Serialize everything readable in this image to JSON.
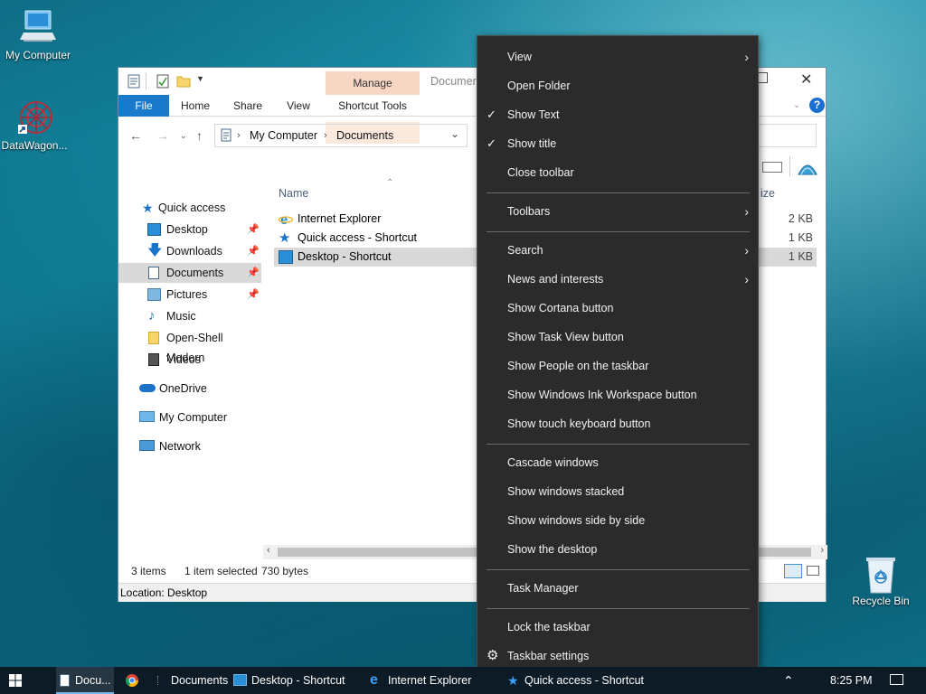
{
  "desktop": {
    "icons": [
      {
        "label": "My Computer",
        "icon": "computer-icon"
      },
      {
        "label": "DataWagon...",
        "icon": "datawagon-icon"
      },
      {
        "label": "Recycle Bin",
        "icon": "recycle-bin-icon"
      }
    ]
  },
  "explorer": {
    "title_partial": "Documer",
    "ribbon": {
      "context_group": "Manage",
      "tabs": [
        "File",
        "Home",
        "Share",
        "View",
        "Shortcut Tools"
      ]
    },
    "address": {
      "crumbs": [
        "My Computer",
        "Documents"
      ]
    },
    "nav_pane": {
      "quick_access_label": "Quick access",
      "quick_items": [
        {
          "label": "Desktop",
          "icon": "desktop-icon",
          "pinned": true
        },
        {
          "label": "Downloads",
          "icon": "downloads-icon",
          "pinned": true
        },
        {
          "label": "Documents",
          "icon": "documents-icon",
          "pinned": true,
          "selected": true
        },
        {
          "label": "Pictures",
          "icon": "pictures-icon",
          "pinned": true
        },
        {
          "label": "Music",
          "icon": "music-icon",
          "pinned": false
        },
        {
          "label": "Open-Shell Modern",
          "icon": "folder-icon",
          "pinned": false
        },
        {
          "label": "Videos",
          "icon": "videos-icon",
          "pinned": false
        }
      ],
      "onedrive_label": "OneDrive",
      "computer_label": "My Computer",
      "network_label": "Network"
    },
    "columns": {
      "name": "Name",
      "size_partial": "ize"
    },
    "files": [
      {
        "name": "Internet Explorer",
        "size": "2 KB",
        "icon": "internet-explorer-icon"
      },
      {
        "name": "Quick access - Shortcut",
        "size": "1 KB",
        "icon": "quick-access-star-icon"
      },
      {
        "name": "Desktop - Shortcut",
        "size": "1 KB",
        "icon": "desktop-shortcut-icon",
        "selected": true
      }
    ],
    "status": {
      "items": "3 items",
      "selected": "1 item selected",
      "bytes": "730 bytes"
    },
    "location": "Location: Desktop"
  },
  "context_menu": {
    "items": [
      {
        "label": "View",
        "submenu": true,
        "checked": false
      },
      {
        "label": "Open Folder",
        "submenu": false,
        "checked": false
      },
      {
        "label": "Show Text",
        "submenu": false,
        "checked": true
      },
      {
        "label": "Show title",
        "submenu": false,
        "checked": true
      },
      {
        "label": "Close toolbar",
        "submenu": false,
        "checked": false
      },
      {
        "separator": true
      },
      {
        "label": "Toolbars",
        "submenu": true,
        "checked": false
      },
      {
        "separator": true
      },
      {
        "label": "Search",
        "submenu": true,
        "checked": false
      },
      {
        "label": "News and interests",
        "submenu": true,
        "checked": false
      },
      {
        "label": "Show Cortana button",
        "submenu": false,
        "checked": false
      },
      {
        "label": "Show Task View button",
        "submenu": false,
        "checked": false
      },
      {
        "label": "Show People on the taskbar",
        "submenu": false,
        "checked": false
      },
      {
        "label": "Show Windows Ink Workspace button",
        "submenu": false,
        "checked": false
      },
      {
        "label": "Show touch keyboard button",
        "submenu": false,
        "checked": false
      },
      {
        "separator": true
      },
      {
        "label": "Cascade windows",
        "submenu": false,
        "checked": false
      },
      {
        "label": "Show windows stacked",
        "submenu": false,
        "checked": false
      },
      {
        "label": "Show windows side by side",
        "submenu": false,
        "checked": false
      },
      {
        "label": "Show the desktop",
        "submenu": false,
        "checked": false
      },
      {
        "separator": true
      },
      {
        "label": "Task Manager",
        "submenu": false,
        "checked": false
      },
      {
        "separator": true
      },
      {
        "label": "Lock the taskbar",
        "submenu": false,
        "checked": false
      },
      {
        "label": "Taskbar settings",
        "submenu": false,
        "checked": false,
        "icon": "gear-icon"
      }
    ]
  },
  "taskbar": {
    "start_icon": "windows-logo-icon",
    "pinned_window": "Docu...",
    "toolbar_title": "Documents",
    "toolbar_items": [
      {
        "label": "Desktop - Shortcut",
        "icon": "desktop-icon"
      },
      {
        "label": "Internet Explorer",
        "icon": "internet-explorer-icon"
      },
      {
        "label": "Quick access - Shortcut",
        "icon": "quick-access-star-icon"
      }
    ],
    "clock": "8:25 PM"
  }
}
